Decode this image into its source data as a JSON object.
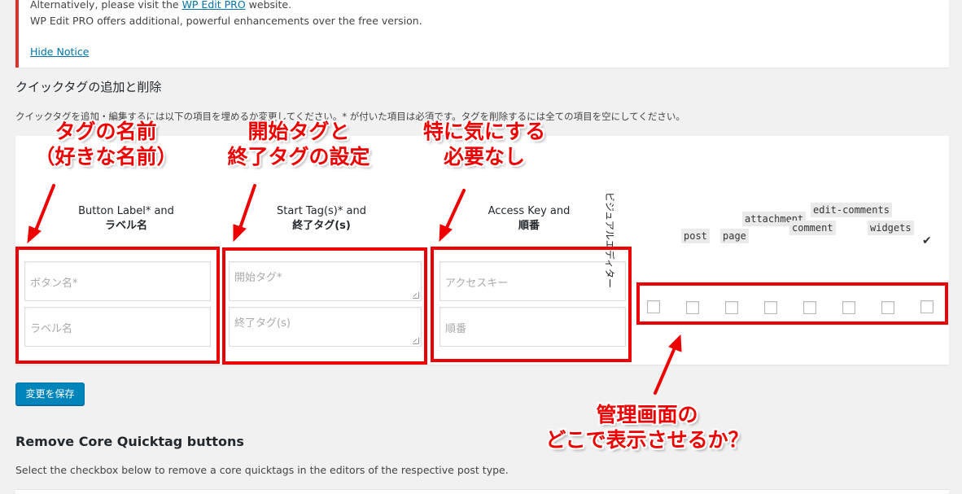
{
  "notice": {
    "line1_prefix": "Alternatively, please visit the ",
    "line1_link": "WP Edit PRO",
    "line1_suffix": " website.",
    "line2": "WP Edit PRO offers additional, powerful enhancements over the free version.",
    "hide_link": "Hide Notice"
  },
  "section": {
    "title": "クイックタグの追加と削除",
    "description": "クイックタグを追加・編集するには以下の項目を埋めるか変更してください。* が付いた項目は必須です。タグを削除するには全ての項目を空にしてください。"
  },
  "columns": {
    "button": {
      "head1": "Button Label* and",
      "head2": "ラベル名",
      "ph1": "ボタン名*",
      "ph2": "ラベル名"
    },
    "tags": {
      "head1": "Start Tag(s)* and",
      "head2": "終了タグ(s)",
      "ph1": "開始タグ*",
      "ph2": "終了タグ(s)"
    },
    "access": {
      "head1": "Access Key and",
      "head2": "順番",
      "ph1": "アクセスキー",
      "ph2": "順番"
    }
  },
  "visual_editor_label": "ビジュアルエディター",
  "post_types": {
    "post": "post",
    "page": "page",
    "attachment": "attachment",
    "comment": "comment",
    "edit_comments": "edit-comments",
    "widgets": "widgets",
    "check": "✔"
  },
  "checkboxes": [
    false,
    false,
    false,
    false,
    false,
    false,
    false,
    false
  ],
  "save_button": "変更を保存",
  "remove_core": {
    "title": "Remove Core Quicktag buttons",
    "description": "Select the checkbox below to remove a core quicktags in the editors of the respective post type."
  },
  "annotations": {
    "a1_line1": "タグの名前",
    "a1_line2": "（好きな名前）",
    "a2_line1": "開始タグと",
    "a2_line2": "終了タグの設定",
    "a3_line1": "特に気にする",
    "a3_line2": "必要なし",
    "a4_line1": "管理画面の",
    "a4_line2": "どこで表示させるか？",
    "color": "#e00000"
  }
}
